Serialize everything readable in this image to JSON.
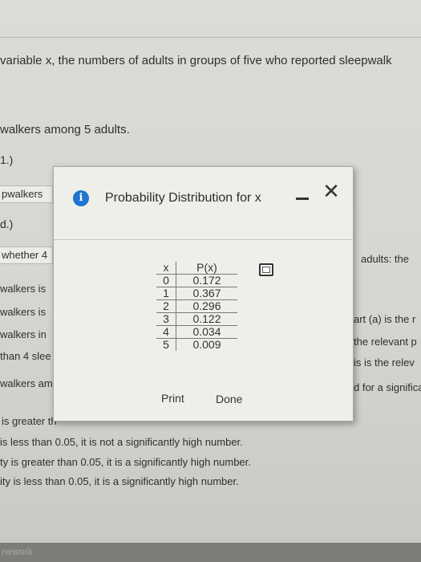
{
  "background": {
    "question_line": "variable x, the numbers of adults in groups of five who reported sleepwalk",
    "sub_line": "walkers among 5 adults.",
    "part_c_label": "1.)",
    "btn_sleepwalkers": "pwalkers",
    "part_d_label": "d.)",
    "btn_whether": "whether 4",
    "btn_walkers_is_1": "walkers is",
    "btn_walkers_is_2": "walkers is",
    "btn_walkers_in": "walkers in",
    "btn_than_4": "than 4 slee",
    "walkers_among": "walkers amo",
    "is_greater_th": "is greater th",
    "option_1": "is less than 0.05, it is not a significantly high number.",
    "option_2": "ty is greater than 0.05, it is a significantly high number.",
    "option_3": "ity is less than 0.05, it is a significantly high number.",
    "right_adults": "adults: the",
    "right_art_a": "art (a) is the r",
    "right_relevant": "the relevant p",
    "right_is_relev": "is is the relev",
    "right_for_signif": "d for a significa",
    "footer": "nework"
  },
  "modal": {
    "title": "Probability Distribution for x",
    "info_icon": "info-icon",
    "minimize_icon": "minimize-icon",
    "close_symbol": "✕",
    "copy_icon": "copy-icon",
    "accent_color": "#1f75d0",
    "table": {
      "headers": [
        "x",
        "P(x)"
      ],
      "rows": [
        [
          "0",
          "0.172"
        ],
        [
          "1",
          "0.367"
        ],
        [
          "2",
          "0.296"
        ],
        [
          "3",
          "0.122"
        ],
        [
          "4",
          "0.034"
        ],
        [
          "5",
          "0.009"
        ]
      ]
    },
    "print_label": "Print",
    "done_label": "Done"
  }
}
